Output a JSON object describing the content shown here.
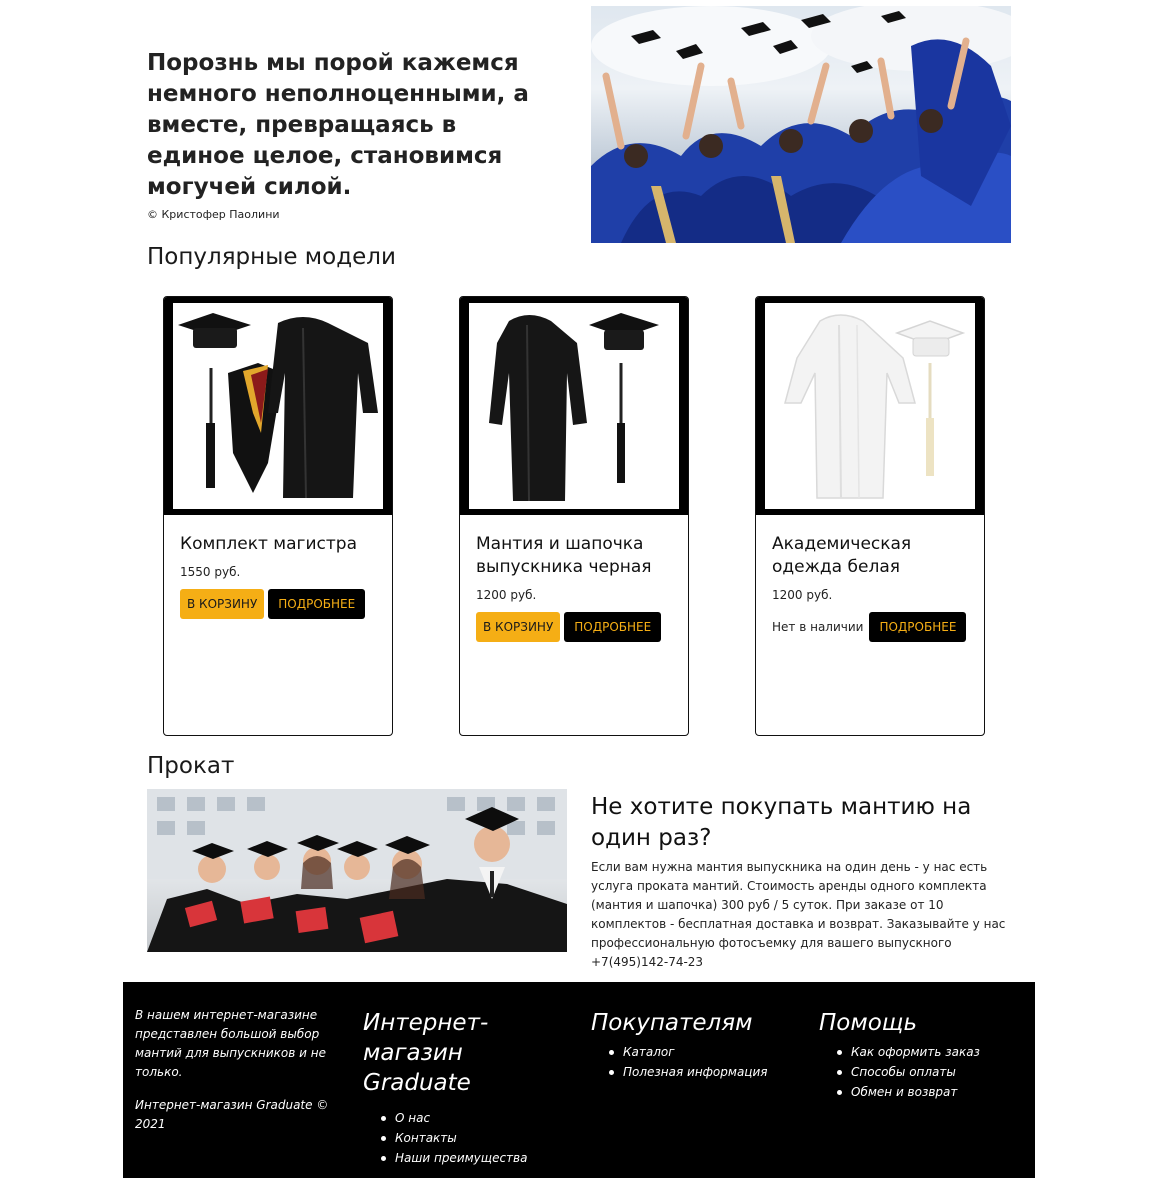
{
  "hero": {
    "quote": "Порознь мы порой кажемся немного неполноценными, а вместе, превращаясь в единое целое, становимся могучей силой.",
    "author": "© Кристофер Паолини"
  },
  "popular": {
    "title": "Популярные модели",
    "products": [
      {
        "name": "Комплект магистра",
        "price": "1550 руб.",
        "cart": "В КОРЗИНУ",
        "more": "ПОДРОБНЕЕ"
      },
      {
        "name": "Мантия и шапочка выпускника черная",
        "price": "1200 руб.",
        "cart": "В КОРЗИНУ",
        "more": "ПОДРОБНЕЕ"
      },
      {
        "name": "Академическая одежда белая",
        "price": "1200 руб.",
        "stock": "Нет в наличии",
        "more": "ПОДРОБНЕЕ"
      }
    ]
  },
  "rental": {
    "title": "Прокат",
    "heading": "Не хотите покупать мантию на один раз?",
    "text": "Если вам нужна мантия выпускника на один день - у нас есть услуга проката мантий. Стоимость аренды одного комплекта (мантия и шапочка) 300 руб / 5 суток. При заказе от 10 комплектов - бесплатная доставка и возврат. Заказывайте у нас профессиональную фотосъемку для вашего выпускного +7(495)142-74-23"
  },
  "footer": {
    "about": "В нашем интернет-магазине представлен большой выбор мантий для выпускников и не только.",
    "copyright": "Интернет-магазин Graduate © 2021",
    "columns": [
      {
        "title": "Интернет-магазин Graduate",
        "links": [
          "О нас",
          "Контакты",
          "Наши преимущества"
        ]
      },
      {
        "title": "Покупателям",
        "links": [
          "Каталог",
          "Полезная информация"
        ]
      },
      {
        "title": "Помощь",
        "links": [
          "Как оформить заказ",
          "Способы оплаты",
          "Обмен и возврат"
        ]
      }
    ]
  },
  "colors": {
    "accent": "#f5ae15",
    "dark": "#000000",
    "text": "#1a1a1a"
  }
}
